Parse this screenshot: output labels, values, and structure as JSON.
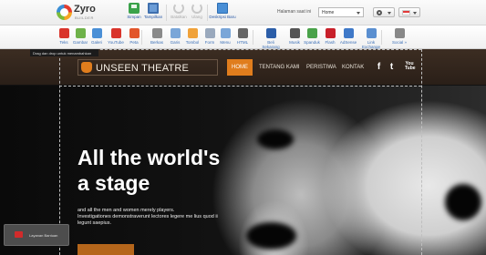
{
  "app": {
    "logo_name": "Zyro",
    "logo_sub": "BUILDER"
  },
  "toolbar": {
    "save_label": "Simpan",
    "view_label": "Tampilkan",
    "undo_label": "Batalkan",
    "redo_label": "Ulang",
    "sites_label": "Deskripsi Baru",
    "current_page_label": "Halaman saat ini",
    "current_page_value": "Home"
  },
  "elements": {
    "items": [
      {
        "label": "Teks",
        "icon": "text-icon",
        "color": "#d9342b"
      },
      {
        "label": "Gambar",
        "icon": "image-icon",
        "color": "#6fb24a"
      },
      {
        "label": "Galeri",
        "icon": "gallery-icon",
        "color": "#4a8fd6"
      },
      {
        "label": "YouTube",
        "icon": "youtube-icon",
        "color": "#d9342b"
      },
      {
        "label": "Peta",
        "icon": "map-pin-icon",
        "color": "#e2562b"
      },
      {
        "label": "Berkas",
        "icon": "file-icon",
        "color": "#8a8a8a"
      },
      {
        "label": "Garis",
        "icon": "line-icon",
        "color": "#7aa6d8"
      },
      {
        "label": "Tombol",
        "icon": "button-icon",
        "color": "#f0a23a"
      },
      {
        "label": "Form",
        "icon": "form-icon",
        "color": "#9aa9bd"
      },
      {
        "label": "Menu",
        "icon": "menu-icon",
        "color": "#7aa6d8"
      },
      {
        "label": "HTML",
        "icon": "html-icon",
        "color": "#666666"
      },
      {
        "label": "Beli Sekarang",
        "icon": "paypal-icon",
        "color": "#2c5ea8"
      },
      {
        "label": "Musik",
        "icon": "music-icon",
        "color": "#555555"
      },
      {
        "label": "Spanduk",
        "icon": "banner-icon",
        "color": "#4aa24a"
      },
      {
        "label": "Flash",
        "icon": "flash-icon",
        "color": "#c8202a"
      },
      {
        "label": "AdSense",
        "icon": "adsense-icon",
        "color": "#3f79c8"
      },
      {
        "label": "Link Exchange",
        "icon": "link-exchange-icon",
        "color": "#5a8fd0"
      },
      {
        "label": "Social »",
        "icon": "social-icon",
        "color": "#888888"
      }
    ],
    "tooltip": "Drag dan drop untuk menambahkan"
  },
  "site": {
    "brand": "UNSEEN THEATRE",
    "nav": [
      "HOME",
      "TENTANG KAMI",
      "PERISTIWA",
      "KONTAK"
    ],
    "active_nav": "HOME",
    "headline_line1": "All the world's",
    "headline_line2": "a stage",
    "body_line1": "and all the men and women merely players.",
    "body_line2": "Investigationes demonstraverunt lectores legere me lius quod ii",
    "body_line3": "legunt saepius.",
    "accent_color": "#e07d1d"
  },
  "chat": {
    "label": "Layanan Bantuan"
  }
}
